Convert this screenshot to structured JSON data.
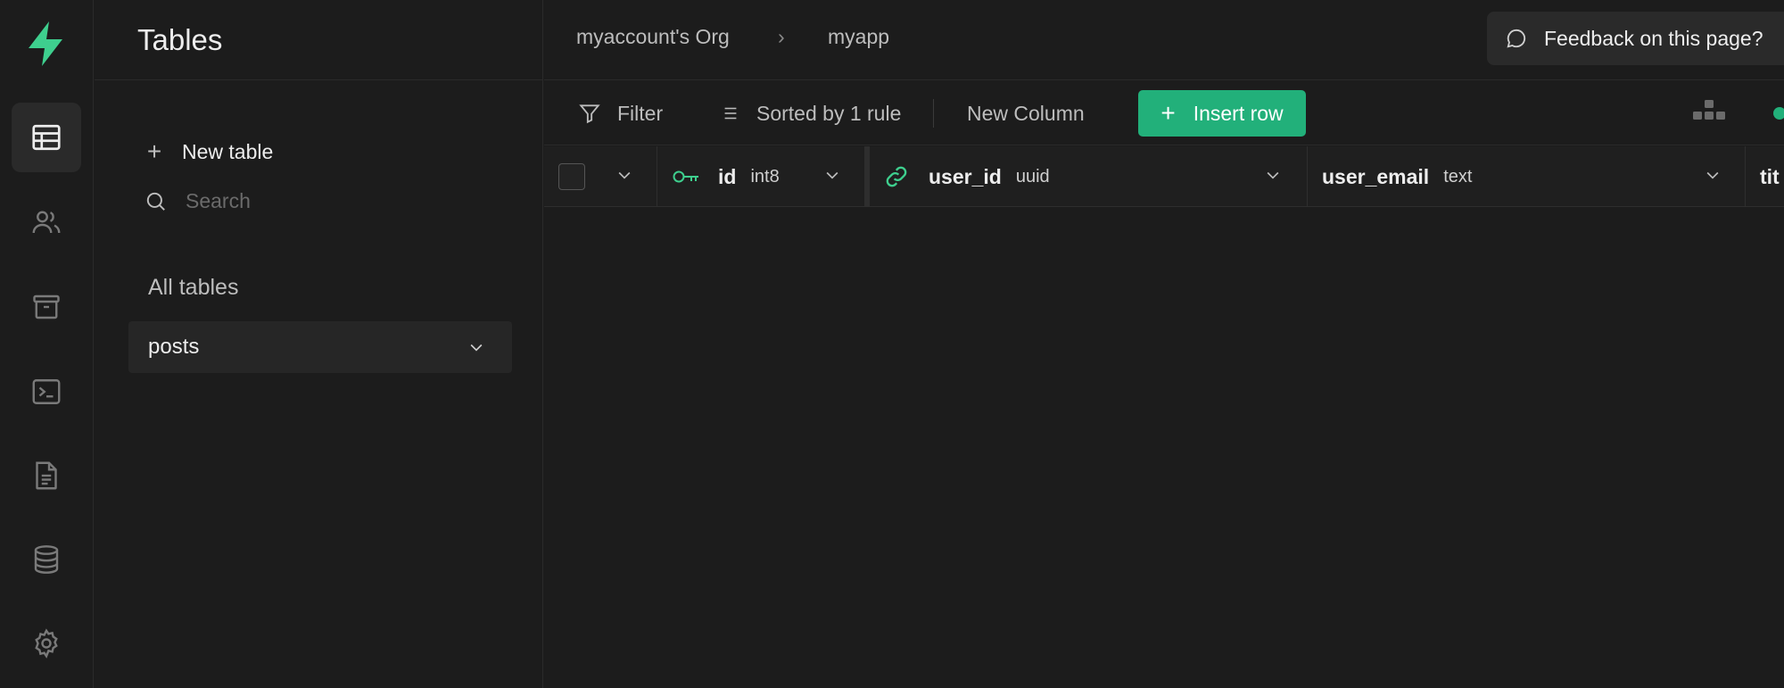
{
  "app": {
    "brand_color": "#3ecf8e",
    "accent": "#22b07a"
  },
  "rail": {
    "items": [
      {
        "icon": "table-editor-icon",
        "active": true
      },
      {
        "icon": "users-icon",
        "active": false
      },
      {
        "icon": "storage-icon",
        "active": false
      },
      {
        "icon": "sql-terminal-icon",
        "active": false
      },
      {
        "icon": "document-icon",
        "active": false
      },
      {
        "icon": "database-icon",
        "active": false
      },
      {
        "icon": "settings-icon",
        "active": false
      }
    ]
  },
  "sidebar": {
    "title": "Tables",
    "new_table_label": "New table",
    "search_placeholder": "Search",
    "section_label": "All tables",
    "tables": [
      {
        "name": "posts"
      }
    ]
  },
  "topbar": {
    "breadcrumb": {
      "org": "myaccount's Org",
      "separator": "›",
      "project": "myapp"
    },
    "feedback_label": "Feedback on this page?"
  },
  "toolbar": {
    "filter_label": "Filter",
    "sort_label": "Sorted by 1 rule",
    "new_column_label": "New Column",
    "insert_row_label": "Insert row"
  },
  "grid": {
    "columns": [
      {
        "name": "id",
        "type": "int8",
        "icon": "primary-key-icon"
      },
      {
        "name": "user_id",
        "type": "uuid",
        "icon": "foreign-key-link-icon"
      },
      {
        "name": "user_email",
        "type": "text",
        "icon": ""
      },
      {
        "name": "tit",
        "type": "",
        "icon": ""
      }
    ],
    "rows": []
  }
}
